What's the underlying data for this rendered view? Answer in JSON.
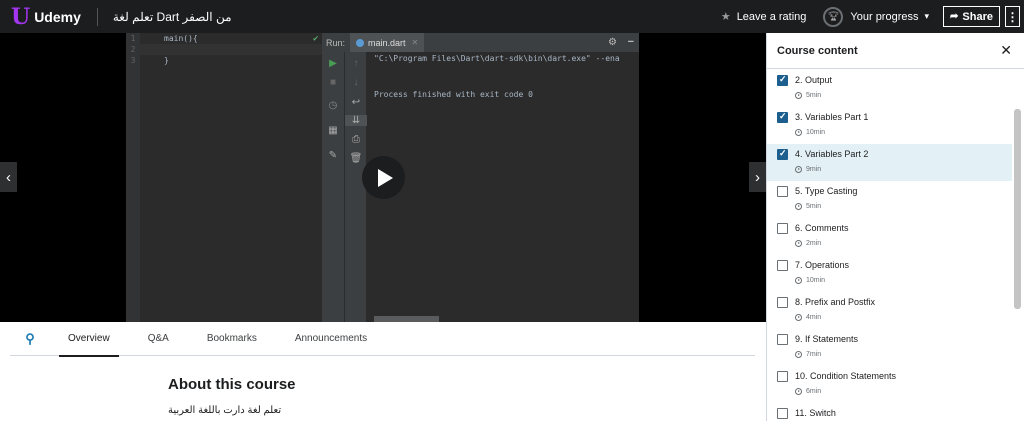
{
  "header": {
    "logo_mark": "U",
    "logo_text": "Udemy",
    "course_title": "تعلم لغة Dart من الصفر",
    "leave_rating": "Leave a rating",
    "your_progress": "Your progress",
    "share": "Share"
  },
  "ide": {
    "line_numbers": [
      "1",
      "2",
      "3"
    ],
    "code_lines": [
      "main(){",
      "",
      "}"
    ],
    "run_label": "Run:",
    "run_tab": "main.dart",
    "console_lines": [
      "\"C:\\Program Files\\Dart\\dart-sdk\\bin\\dart.exe\" --ena",
      "",
      "",
      "Process finished with exit code 0"
    ]
  },
  "tabs": {
    "items": [
      "Overview",
      "Q&A",
      "Bookmarks",
      "Announcements"
    ],
    "active": "Overview"
  },
  "about": {
    "title": "About this course",
    "description": "تعلم لغة دارت باللغة العربية"
  },
  "sidebar": {
    "title": "Course content",
    "lectures": [
      {
        "title": "2. Output",
        "duration": "5min",
        "completed": true,
        "current": false
      },
      {
        "title": "3. Variables Part 1",
        "duration": "10min",
        "completed": true,
        "current": false
      },
      {
        "title": "4. Variables Part 2",
        "duration": "9min",
        "completed": true,
        "current": true
      },
      {
        "title": "5. Type Casting",
        "duration": "5min",
        "completed": false,
        "current": false
      },
      {
        "title": "6. Comments",
        "duration": "2min",
        "completed": false,
        "current": false
      },
      {
        "title": "7. Operations",
        "duration": "10min",
        "completed": false,
        "current": false
      },
      {
        "title": "8. Prefix and Postfix",
        "duration": "4min",
        "completed": false,
        "current": false
      },
      {
        "title": "9. If Statements",
        "duration": "7min",
        "completed": false,
        "current": false
      },
      {
        "title": "10. Condition Statements",
        "duration": "6min",
        "completed": false,
        "current": false
      },
      {
        "title": "11. Switch",
        "duration": "",
        "completed": false,
        "current": false
      }
    ]
  },
  "colors": {
    "topbar": "#1c1d1f",
    "brand": "#a435f0",
    "checkbox": "#1c5f8e",
    "active_lecture": "#e3f0f5"
  }
}
